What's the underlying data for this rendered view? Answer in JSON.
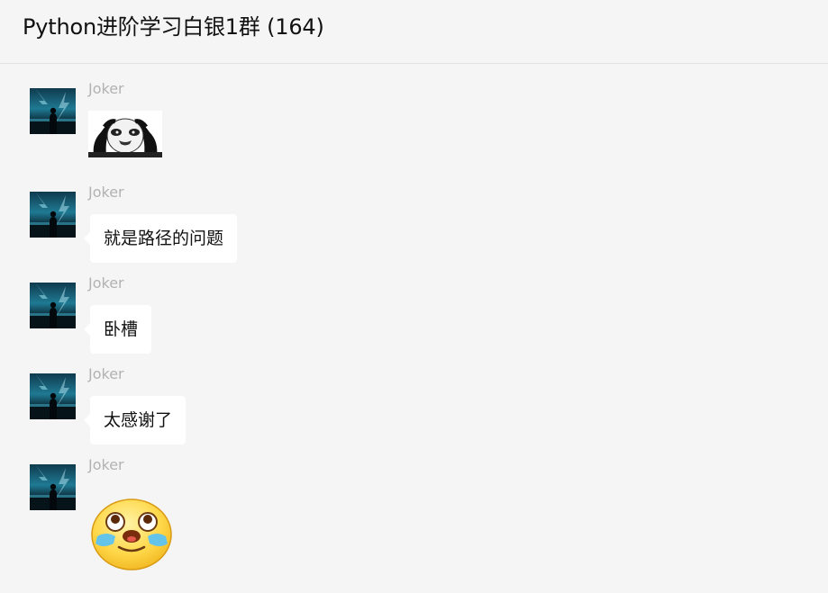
{
  "header": {
    "title": "Python进阶学习白银1群 (164)"
  },
  "messages": [
    {
      "sender": "Joker",
      "type": "sticker",
      "sticker": "panda-meme-sticker"
    },
    {
      "sender": "Joker",
      "type": "text",
      "text": "就是路径的问题"
    },
    {
      "sender": "Joker",
      "type": "text",
      "text": "卧槽"
    },
    {
      "sender": "Joker",
      "type": "text",
      "text": "太感谢了"
    },
    {
      "sender": "Joker",
      "type": "sticker",
      "sticker": "crying-face-sticker"
    }
  ],
  "colors": {
    "background": "#f5f5f5",
    "bubble": "#ffffff",
    "sender_name": "#b2b2b2",
    "divider": "#e2e2e2"
  }
}
